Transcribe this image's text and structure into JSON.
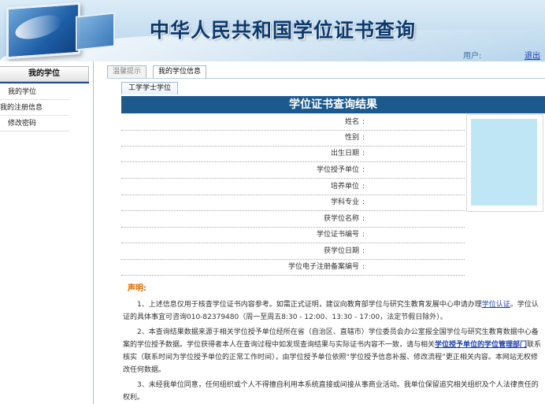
{
  "header": {
    "site_title": "中华人民共和国学位证书查询",
    "user_label": "用户:",
    "logout_label": "退出"
  },
  "sidebar": {
    "title": "我的学位",
    "items": [
      {
        "label": "我的学位"
      },
      {
        "label": "我的注册信息"
      },
      {
        "label": "修改密码"
      }
    ]
  },
  "tabs": [
    {
      "label": "温馨提示",
      "active": false
    },
    {
      "label": "我的学位信息",
      "active": true
    }
  ],
  "subtab": {
    "label": "工学学士学位"
  },
  "result": {
    "heading": "学位证书查询结果",
    "fields": [
      {
        "label": "姓名",
        "value": ""
      },
      {
        "label": "性别",
        "value": ""
      },
      {
        "label": "出生日期",
        "value": ""
      },
      {
        "label": "学位授予单位",
        "value": ""
      },
      {
        "label": "培养单位",
        "value": ""
      },
      {
        "label": "学科专业",
        "value": ""
      },
      {
        "label": "获学位名称",
        "value": ""
      },
      {
        "label": "学位证书编号",
        "value": ""
      },
      {
        "label": "获学位日期",
        "value": ""
      },
      {
        "label": "学位电子注册备案编号",
        "value": ""
      }
    ],
    "colon": ":"
  },
  "declaration": {
    "title": "声明:",
    "p1_a": "1、上述信息仅用于核查学位证书内容参考。如需正式证明，建议向教育部学位与研究生教育发展中心申请办理",
    "p1_link": "学位认证",
    "p1_b": "。学位认证的具体事宜可咨询010-82379480（周一至周五8:30 - 12:00、13:30 - 17:00，法定节假日除外）。",
    "p2_a": "2、本查询结果数据来源于相关学位授予单位经所在省（自治区、直辖市）学位委员会办公室报全国学位与研究生教育数据中心备案的学位授予数据。学位获得者本人在查询过程中如发现查询结果与实际证书内容不一致，请与相关",
    "p2_link": "学位授予单位的学位管理部门",
    "p2_b": "联系核实（联系时间为学位授予单位的正常工作时间），由学位授予单位依照“学位授予信息补报、修改流程”更正相关内容。本网站无权修改任何数据。",
    "p3": "3、未经我单位同意，任何组织或个人不得擅自利用本系统直接或间接从事商业活动。我单位保留追究相关组织及个人法律责任的权利。"
  }
}
